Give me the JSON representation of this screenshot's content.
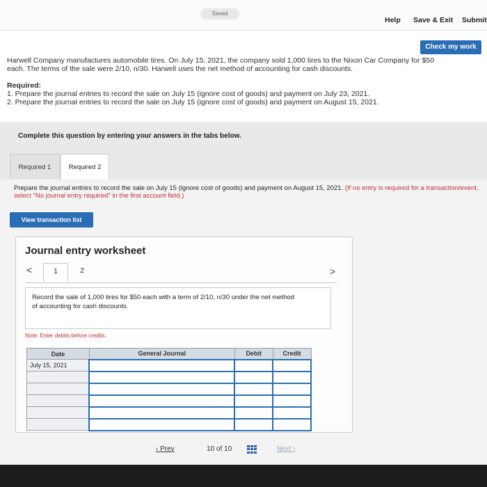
{
  "topbar": {
    "saved": "Saved",
    "help": "Help",
    "save_exit": "Save & Exit",
    "submit": "Submit"
  },
  "check_button": "Check my work",
  "problem": {
    "line1": "Harwell Company manufactures automobile tires. On July 15, 2021, the company sold 1,000 tires to the Nixon Car Company for $50",
    "line2": "each. The terms of the sale were 2/10, n/30. Harwell uses the net method of accounting for cash discounts.",
    "required_label": "Required:",
    "req1": "1. Prepare the journal entries to record the sale on July 15 (ignore cost of goods) and payment on July 23, 2021.",
    "req2": "2. Prepare the journal entries to record the sale on July 15 (ignore cost of goods) and payment on August 15, 2021."
  },
  "complete_text": "Complete this question by entering your answers in the tabs below.",
  "tabs": [
    {
      "label": "Required 1"
    },
    {
      "label": "Required 2"
    }
  ],
  "instructions": {
    "main": "Prepare the journal entries to record the sale on July 15 (ignore cost of goods) and payment on August 15, 2021.",
    "red": "(If no entry is required for a transaction/event, select \"No journal entry required\" in the first account field.)"
  },
  "view_transaction_list": "View transaction list",
  "worksheet": {
    "title": "Journal entry worksheet",
    "prev_arrow": "<",
    "next_arrow": ">",
    "pages": [
      "1",
      "2"
    ],
    "record_text": "Record the sale of 1,000 tires for $50 each with a term of 2/10, n/30 under the net method of accounting for cash discounts.",
    "note": "Note: Enter debits before credits."
  },
  "journal": {
    "headers": [
      "Date",
      "General Journal",
      "Debit",
      "Credit"
    ],
    "rows": [
      {
        "date": "July 15, 2021"
      },
      {
        "date": ""
      },
      {
        "date": ""
      },
      {
        "date": ""
      },
      {
        "date": ""
      },
      {
        "date": ""
      }
    ]
  },
  "pager": {
    "prev": "Prev",
    "page": "10",
    "of": "of",
    "total": "10",
    "next": "Next"
  },
  "colors": {
    "accent": "#2a6db5",
    "note_red": "#c03030",
    "header_bg": "#d5dbe3"
  }
}
